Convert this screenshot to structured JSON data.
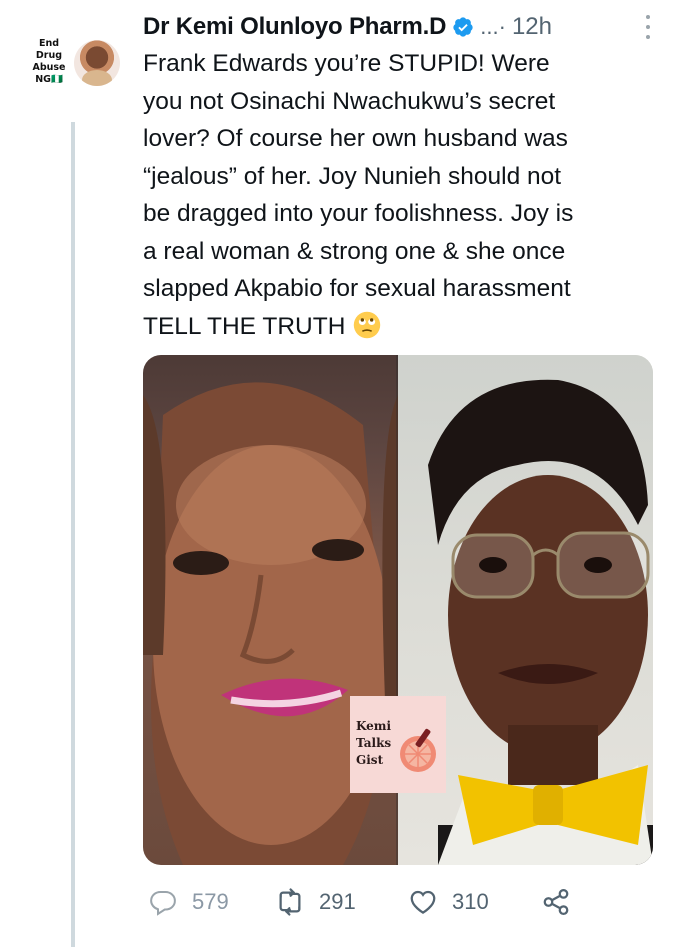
{
  "avatar": {
    "label_lines": [
      "End",
      "Drug",
      "Abuse",
      "NG🇳🇬"
    ]
  },
  "header": {
    "display_name": "Dr Kemi Olunloyo Pharm.D",
    "separator": "...·",
    "timestamp": "12h"
  },
  "tweet": {
    "text": "Frank Edwards you’re STUPID! Were\nyou not Osinachi Nwachukwu’s secret\nlover? Of course her own husband was\n“jealous” of her. Joy Nunieh should not\nbe dragged into your foolishness. Joy is\na real woman & strong one & she once\nslapped Akpabio for sexual harassment\nTELL THE TRUTH",
    "emoji": "face-with-rolling-eyes"
  },
  "media": {
    "watermark_lines": [
      "Kemi",
      "Talks",
      "Gist"
    ]
  },
  "actions": {
    "replies": "579",
    "retweets": "291",
    "likes": "310"
  },
  "colors": {
    "verified": "#1d9bf0",
    "secondary_text": "#536471",
    "thread_line": "#cfd9de"
  }
}
